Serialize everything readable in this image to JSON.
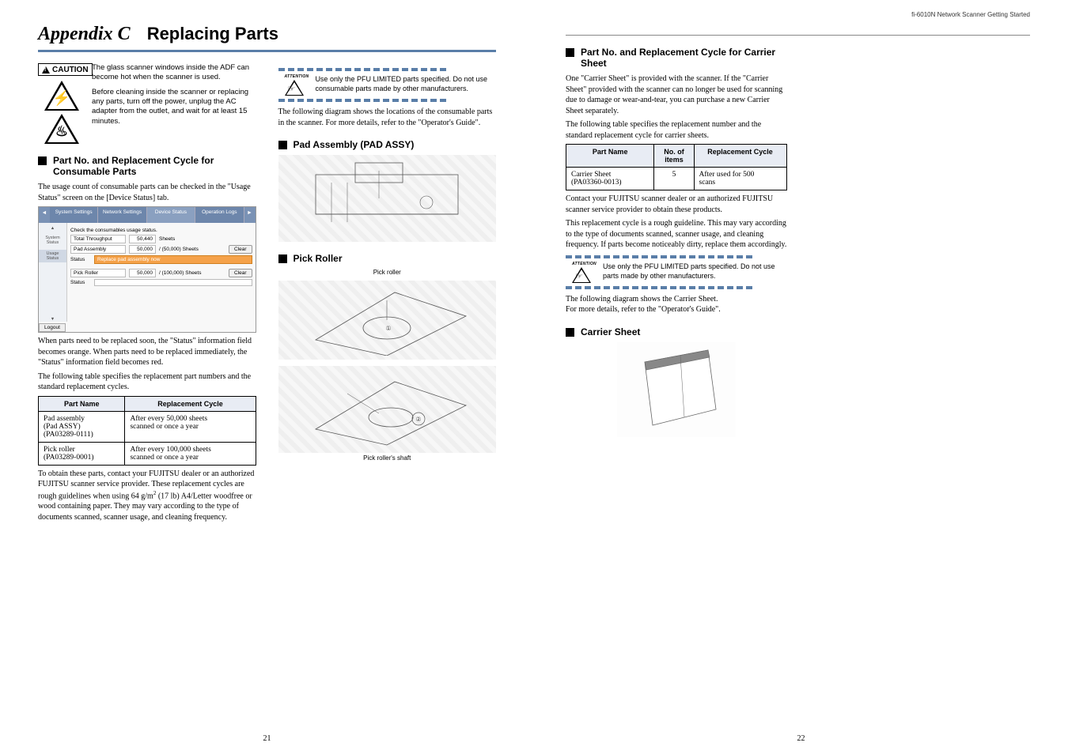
{
  "running_head": "fi-6010N Network Scanner Getting Started",
  "chapter": {
    "num": "Appendix C",
    "title": "Replacing Parts"
  },
  "caution_label": "CAUTION",
  "caution_p1": "The glass scanner windows inside the ADF can become hot when the scanner is used.",
  "caution_p2": "Before cleaning inside the scanner or replacing any parts, turn off the power, unplug the AC adapter from the outlet, and wait for at least 15 minutes.",
  "sec_consumable": "Part No. and Replacement Cycle for Consumable Parts",
  "consumable_intro": "The usage count of consumable parts can be checked in the \"Usage Status\" screen on the [Device Status] tab.",
  "ui": {
    "tabs": [
      "System Settings",
      "Network Settings",
      "Device Status",
      "Operation Logs"
    ],
    "check_line": "Check the consumables usage status.",
    "side": {
      "system": "System Status",
      "usage": "Usage Status"
    },
    "throughput_label": "Total Throughput",
    "throughput_val": "50,440",
    "throughput_unit": "Sheets",
    "pad_label": "Pad Assembly",
    "pad_val": "50,000",
    "pad_of": "/ (50,000) Sheets",
    "status_label": "Status",
    "status_pad": "Replace pad assembly now",
    "pick_label": "Pick Roller",
    "pick_val": "50,000",
    "pick_of": "/ (100,000) Sheets",
    "clear": "Clear",
    "logout": "Logout"
  },
  "consumable_after1": "When parts need to be replaced soon, the \"Status\" information field becomes orange. When parts need to be replaced immediately, the \"Status\" information field becomes red.",
  "consumable_after2": "The following table specifies the replacement part numbers and the standard replacement cycles.",
  "table1": {
    "h1": "Part Name",
    "h2": "Replacement Cycle",
    "r1c1a": "Pad assembly",
    "r1c1b": "(Pad ASSY)",
    "r1c1c": "(PA03289-0111)",
    "r1c2a": "After every 50,000 sheets",
    "r1c2b": "scanned or once a year",
    "r2c1a": "Pick roller",
    "r2c1b": "(PA03289-0001)",
    "r2c2a": "After every 100,000 sheets",
    "r2c2b": "scanned or once a year"
  },
  "consumable_after3_a": "To obtain these parts, contact your FUJITSU dealer or an authorized FUJITSU scanner service provider.",
  "consumable_after3_b": "These replacement cycles are rough guidelines when using 64 g/m",
  "consumable_after3_c": " (17 lb) A4/Letter woodfree or wood containing paper. They may vary according to the type of documents scanned, scanner usage, and cleaning frequency.",
  "attn1": {
    "label": "ATTENTION",
    "text": "Use only the PFU LIMITED parts specified. Do not use consumable parts made by other manufacturers."
  },
  "diag_intro": "The following diagram shows the locations of the consumable parts in the scanner. For more details, refer to the \"Operator's Guide\".",
  "sec_pad": "Pad Assembly (PAD ASSY)",
  "sec_pick": "Pick Roller",
  "pick_label_top": "Pick roller",
  "pick_label_bottom": "Pick roller's shaft",
  "sec_carrier_cycle": "Part No. and Replacement Cycle for Carrier Sheet",
  "carrier_p1": "One \"Carrier Sheet\" is provided with the scanner. If the \"Carrier Sheet\" provided with the scanner can no longer be used for scanning due to damage or wear-and-tear, you can purchase a new Carrier Sheet separately.",
  "carrier_p2": "The following table specifies the replacement number and the standard replacement cycle for carrier sheets.",
  "table2": {
    "h1": "Part Name",
    "h2": "No. of items",
    "h3": "Replacement Cycle",
    "r1c1a": "Carrier Sheet",
    "r1c1b": "(PA03360-0013)",
    "r1c2": "5",
    "r1c3a": "After used for 500",
    "r1c3b": "scans"
  },
  "carrier_p3": "Contact your FUJITSU scanner dealer or an authorized FUJITSU scanner service provider to obtain these products.",
  "carrier_p4": "This replacement cycle is a rough guideline. This may vary according to the type of documents scanned, scanner usage, and cleaning frequency. If parts become noticeably dirty, replace them accordingly.",
  "attn2": {
    "label": "ATTENTION",
    "text": "Use only the PFU LIMITED parts specified. Do not use parts made by other manufacturers."
  },
  "carrier_p5": "The following diagram shows the Carrier Sheet.",
  "carrier_p6": "For more details, refer to the \"Operator's Guide\".",
  "sec_carrier": "Carrier Sheet",
  "pg_left": "21",
  "pg_right": "22"
}
